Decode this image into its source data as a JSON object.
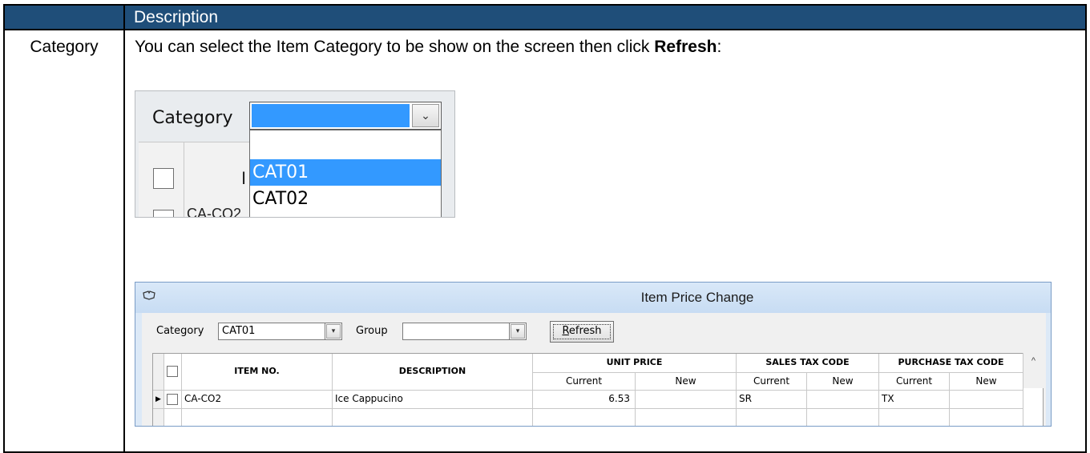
{
  "doc_table": {
    "header_label": "Description",
    "row_label": "Category",
    "intro_text_before": "You can select the Item Category to be show on the screen then click ",
    "intro_text_bold": "Refresh",
    "intro_text_after": ":"
  },
  "dropdown_shot": {
    "label": "Category",
    "arrow": "⌄",
    "options": [
      "",
      "CAT01",
      "CAT02"
    ],
    "highlighted": "CAT01",
    "grid_partial_text": "CA-CO2",
    "grid_partial_header": "I"
  },
  "window": {
    "title": "Item Price Change",
    "icon": "book-icon",
    "category_label": "Category",
    "category_value": "CAT01",
    "group_label": "Group",
    "group_value": "",
    "refresh_label_first": "R",
    "refresh_label_rest": "efresh",
    "scroll_up": "^",
    "columns": {
      "item_no": "ITEM NO.",
      "description": "DESCRIPTION",
      "unit_price": "UNIT PRICE",
      "sales_tax_code": "SALES TAX CODE",
      "purchase_tax_code": "PURCHASE TAX CODE",
      "current": "Current",
      "new": "New"
    },
    "rows": [
      {
        "item_no": "CA-CO2",
        "description": "Ice Cappucino",
        "unit_price_current": "6.53",
        "unit_price_new": "",
        "sales_tax_current": "SR",
        "sales_tax_new": "",
        "purchase_tax_current": "TX",
        "purchase_tax_new": ""
      }
    ]
  }
}
